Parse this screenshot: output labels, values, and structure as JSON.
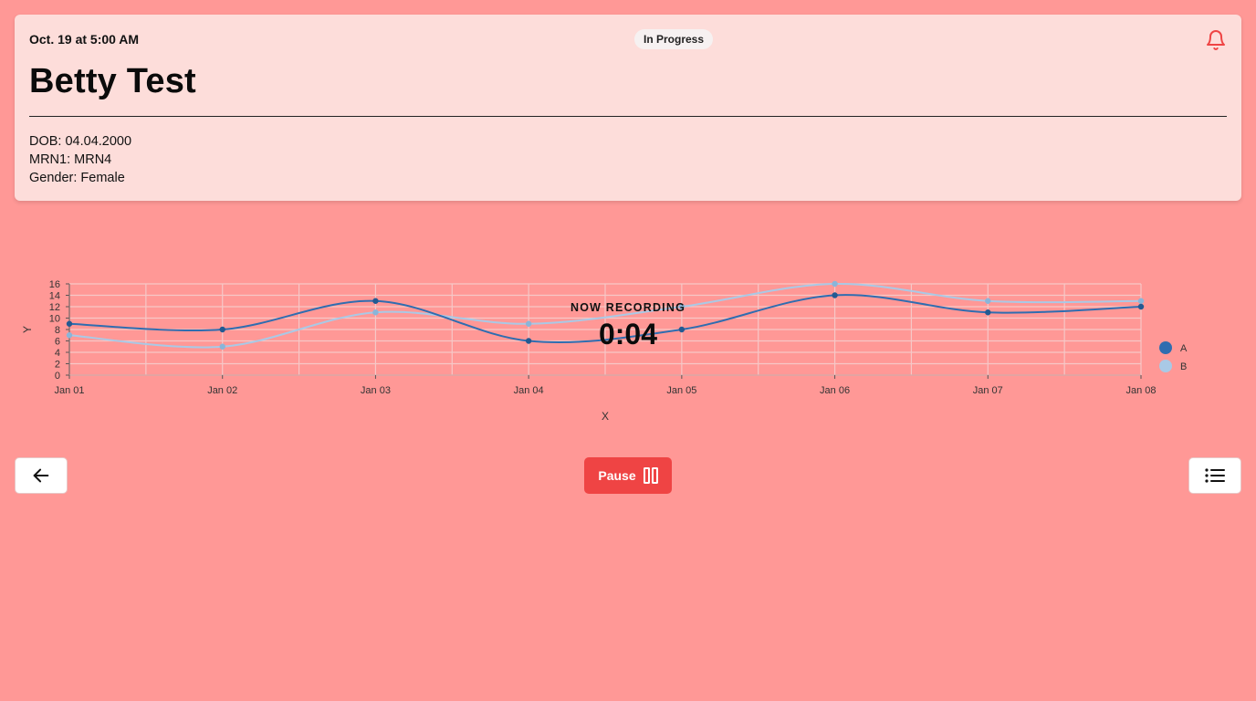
{
  "header": {
    "datetime": "Oct. 19 at 5:00 AM",
    "status": "In Progress",
    "patient_name": "Betty Test",
    "dob": "DOB: 04.04.2000",
    "mrn": "MRN1: MRN4",
    "gender": "Gender: Female",
    "bell_icon": "bell-icon",
    "accent_color": "#ef4444"
  },
  "recording": {
    "label": "NOW RECORDING",
    "timer": "0:04"
  },
  "controls": {
    "pause_label": "Pause",
    "pause_icon": "pause-icon",
    "back_icon": "arrow-left-icon",
    "menu_icon": "list-icon"
  },
  "chart_data": {
    "type": "line",
    "xlabel": "X",
    "ylabel": "Y",
    "categories": [
      "Jan 01",
      "Jan 02",
      "Jan 03",
      "Jan 04",
      "Jan 05",
      "Jan 06",
      "Jan 07",
      "Jan 08"
    ],
    "yticks": [
      0,
      2,
      4,
      6,
      8,
      10,
      12,
      14,
      16
    ],
    "ylim": [
      0,
      16
    ],
    "grid": true,
    "legend_position": "right",
    "series": [
      {
        "name": "A",
        "color": "#2f6db0",
        "values": [
          9,
          8,
          13,
          6,
          8,
          14,
          11,
          12
        ]
      },
      {
        "name": "B",
        "color": "#a9c9e6",
        "values": [
          7,
          5,
          11,
          9,
          12,
          16,
          13,
          13
        ]
      }
    ]
  }
}
